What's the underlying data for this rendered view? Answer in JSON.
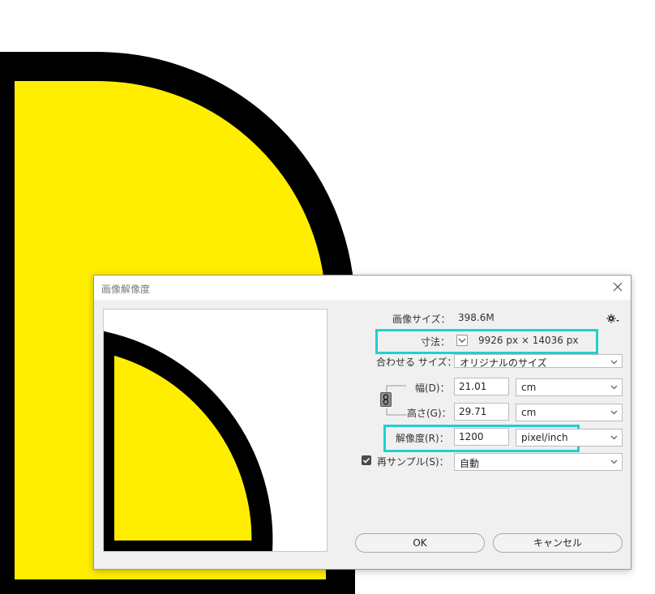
{
  "dialog": {
    "title": "画像解像度",
    "image_size_label": "画像サイズ：",
    "image_size_value": "398.6M",
    "dimensions_label": "寸法：",
    "dimensions_value": "9926 px × 14036 px",
    "fit_label": "合わせる サイズ：",
    "fit_value": "オリジナルのサイズ",
    "width_label": "幅(D)：",
    "width_value": "21.01",
    "width_unit": "cm",
    "height_label": "高さ(G)：",
    "height_value": "29.71",
    "height_unit": "cm",
    "resolution_label": "解像度(R)：",
    "resolution_value": "1200",
    "resolution_unit": "pixel/inch",
    "resample_label": "再サンプル(S)：",
    "resample_checked": true,
    "resample_value": "自動",
    "ok_label": "OK",
    "cancel_label": "キャンセル"
  },
  "colors": {
    "highlight": "#20d0d0",
    "artwork_fill": "#ffee00",
    "artwork_stroke": "#000000"
  }
}
